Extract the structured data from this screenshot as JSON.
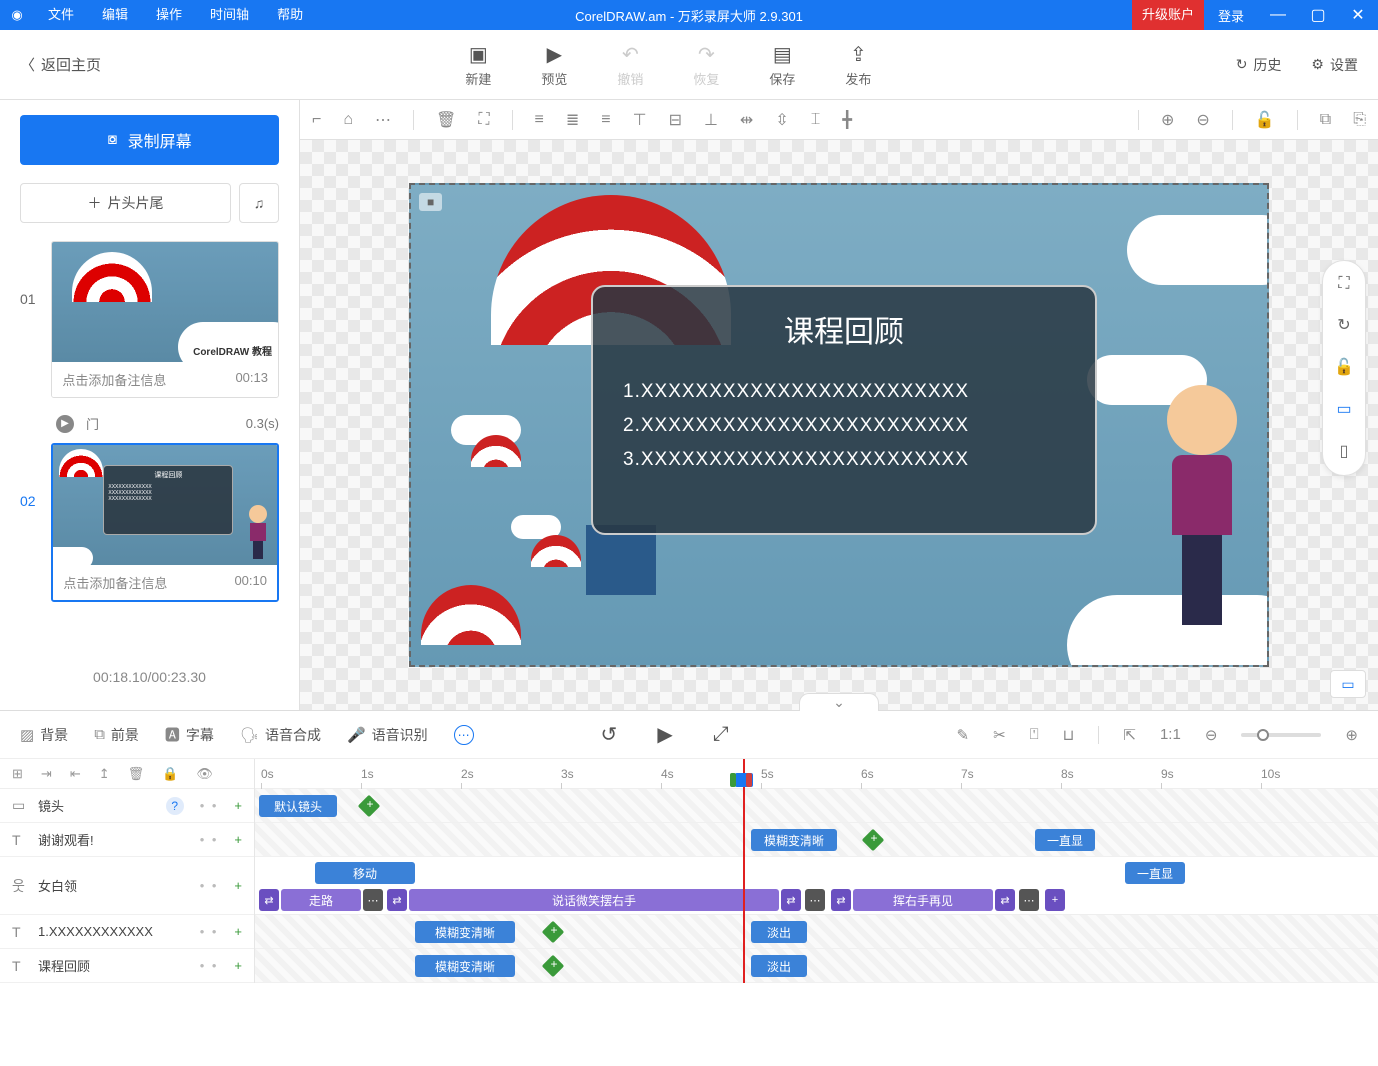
{
  "titlebar": {
    "menus": [
      "文件",
      "编辑",
      "操作",
      "时间轴",
      "帮助"
    ],
    "document": "CorelDRAW.am",
    "app": "万彩录屏大师 2.9.301",
    "upgrade": "升级账户",
    "login": "登录"
  },
  "toolbar": {
    "back": "返回主页",
    "actions": [
      {
        "label": "新建",
        "icon": "＋"
      },
      {
        "label": "预览",
        "icon": "▶"
      },
      {
        "label": "撤销",
        "icon": "↶",
        "disabled": true
      },
      {
        "label": "恢复",
        "icon": "↷",
        "disabled": true
      },
      {
        "label": "保存",
        "icon": "▤"
      },
      {
        "label": "发布",
        "icon": "⇪"
      }
    ],
    "history": "历史",
    "settings": "设置"
  },
  "sidebar": {
    "record": "录制屏幕",
    "add_headtail": "片头片尾",
    "slides": [
      {
        "num": "01",
        "thumb_caption": "CorelDRAW 教程",
        "note": "点击添加备注信息",
        "time": "00:13"
      },
      {
        "num": "02",
        "thumb_caption": "课程回顾",
        "note": "点击添加备注信息",
        "time": "00:10"
      }
    ],
    "transition": {
      "name": "门",
      "dur": "0.3(s)"
    },
    "time_display": "00:18.10/00:23.30"
  },
  "stage": {
    "title": "课程回顾",
    "lines": [
      "1.XXXXXXXXXXXXXXXXXXXXXXXX",
      "2.XXXXXXXXXXXXXXXXXXXXXXXX",
      "3.XXXXXXXXXXXXXXXXXXXXXXXX"
    ]
  },
  "tl_tabs": [
    {
      "label": "背景"
    },
    {
      "label": "前景"
    },
    {
      "label": "字幕"
    },
    {
      "label": "语音合成"
    },
    {
      "label": "语音识别"
    }
  ],
  "ruler": [
    "0s",
    "1s",
    "2s",
    "3s",
    "4s",
    "5s",
    "6s",
    "7s",
    "8s",
    "9s",
    "10s"
  ],
  "tracks": {
    "camera": {
      "label": "镜头",
      "clip": "默认镜头"
    },
    "t1": {
      "label": "谢谢观看!",
      "clip": "模糊变清晰",
      "end": "一直显"
    },
    "char": {
      "label": "女白领",
      "top_clip": "移动",
      "end": "一直显",
      "segs": [
        "走路",
        "说话微笑摆右手",
        "挥右手再见"
      ]
    },
    "t2": {
      "label": "1.XXXXXXXXXXXX",
      "clip": "模糊变清晰",
      "out": "淡出"
    },
    "t3": {
      "label": "课程回顾",
      "clip": "模糊变清晰",
      "out": "淡出"
    }
  }
}
